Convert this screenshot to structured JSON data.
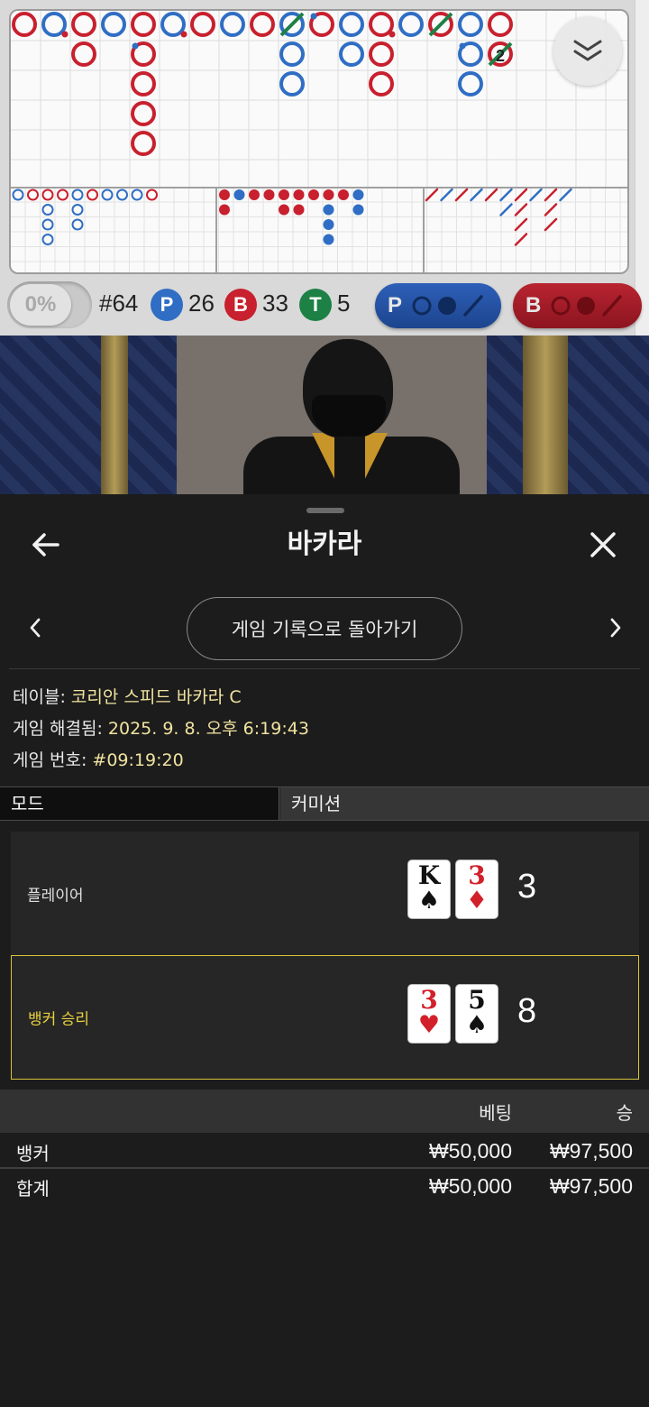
{
  "scoreboard": {
    "percentage": "0%",
    "round_label": "#64",
    "player_badge": "P",
    "player_count": "26",
    "banker_badge": "B",
    "banker_count": "33",
    "tie_badge": "T",
    "tie_count": "5",
    "player_predict_label": "P",
    "banker_predict_label": "B",
    "big_road_annotation": "2",
    "colors": {
      "player": "#2f6ec4",
      "banker": "#c8202e",
      "tie": "#1d8045"
    }
  },
  "sheet": {
    "title": "바카라",
    "return_button": "게임 기록으로 돌아가기",
    "table_label": "테이블:",
    "table_value": "코리안 스피드 바카라 C",
    "resolved_label": "게임 해결됨:",
    "resolved_value": "2025. 9. 8. 오후 6:19:43",
    "number_label": "게임 번호:",
    "number_value": "#09:19:20",
    "tab_mode": "모드",
    "tab_commission": "커미션",
    "player_hand": {
      "label": "플레이어",
      "cards": [
        {
          "rank": "K",
          "suit": "♠"
        },
        {
          "rank": "3",
          "suit": "♦"
        }
      ],
      "score": "3"
    },
    "banker_hand": {
      "label": "뱅커 승리",
      "cards": [
        {
          "rank": "3",
          "suit": "♥"
        },
        {
          "rank": "5",
          "suit": "♠"
        }
      ],
      "score": "8"
    },
    "bets": {
      "col_bet": "베팅",
      "col_win": "승",
      "rows": [
        {
          "label": "뱅커",
          "bet": "₩50,000",
          "win": "₩97,500"
        },
        {
          "label": "합계",
          "bet": "₩50,000",
          "win": "₩97,500"
        }
      ]
    }
  }
}
